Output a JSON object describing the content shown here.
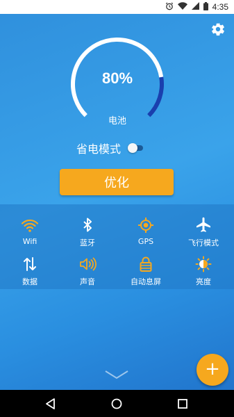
{
  "statusbar": {
    "time": "4:35",
    "icons": [
      "alarm-icon",
      "wifi-icon",
      "signal-icon",
      "battery-icon"
    ]
  },
  "settings": {
    "icon": "gear-icon"
  },
  "battery": {
    "percent_text": "80%",
    "level": 0.8,
    "label": "电池"
  },
  "power_save": {
    "label": "省电模式",
    "enabled": false
  },
  "optimize": {
    "label": "优化"
  },
  "quick_settings": [
    {
      "label": "Wifi",
      "icon": "wifi-icon",
      "active": true
    },
    {
      "label": "蓝牙",
      "icon": "bluetooth-icon",
      "active": false
    },
    {
      "label": "GPS",
      "icon": "gps-icon",
      "active": true
    },
    {
      "label": "飞行模式",
      "icon": "airplane-icon",
      "active": false
    },
    {
      "label": "数据",
      "icon": "data-arrows-icon",
      "active": false
    },
    {
      "label": "声音",
      "icon": "volume-icon",
      "active": true
    },
    {
      "label": "自动息屏",
      "icon": "lock-icon",
      "active": true
    },
    {
      "label": "亮度",
      "icon": "brightness-icon",
      "active": true
    }
  ],
  "fab": {
    "label": "+"
  },
  "colors": {
    "accent": "#f6a81e",
    "gauge_fill": "#1a3fae",
    "gauge_track": "#ffffff"
  },
  "navbar": {
    "icons": [
      "back-icon",
      "home-icon",
      "recents-icon"
    ]
  }
}
